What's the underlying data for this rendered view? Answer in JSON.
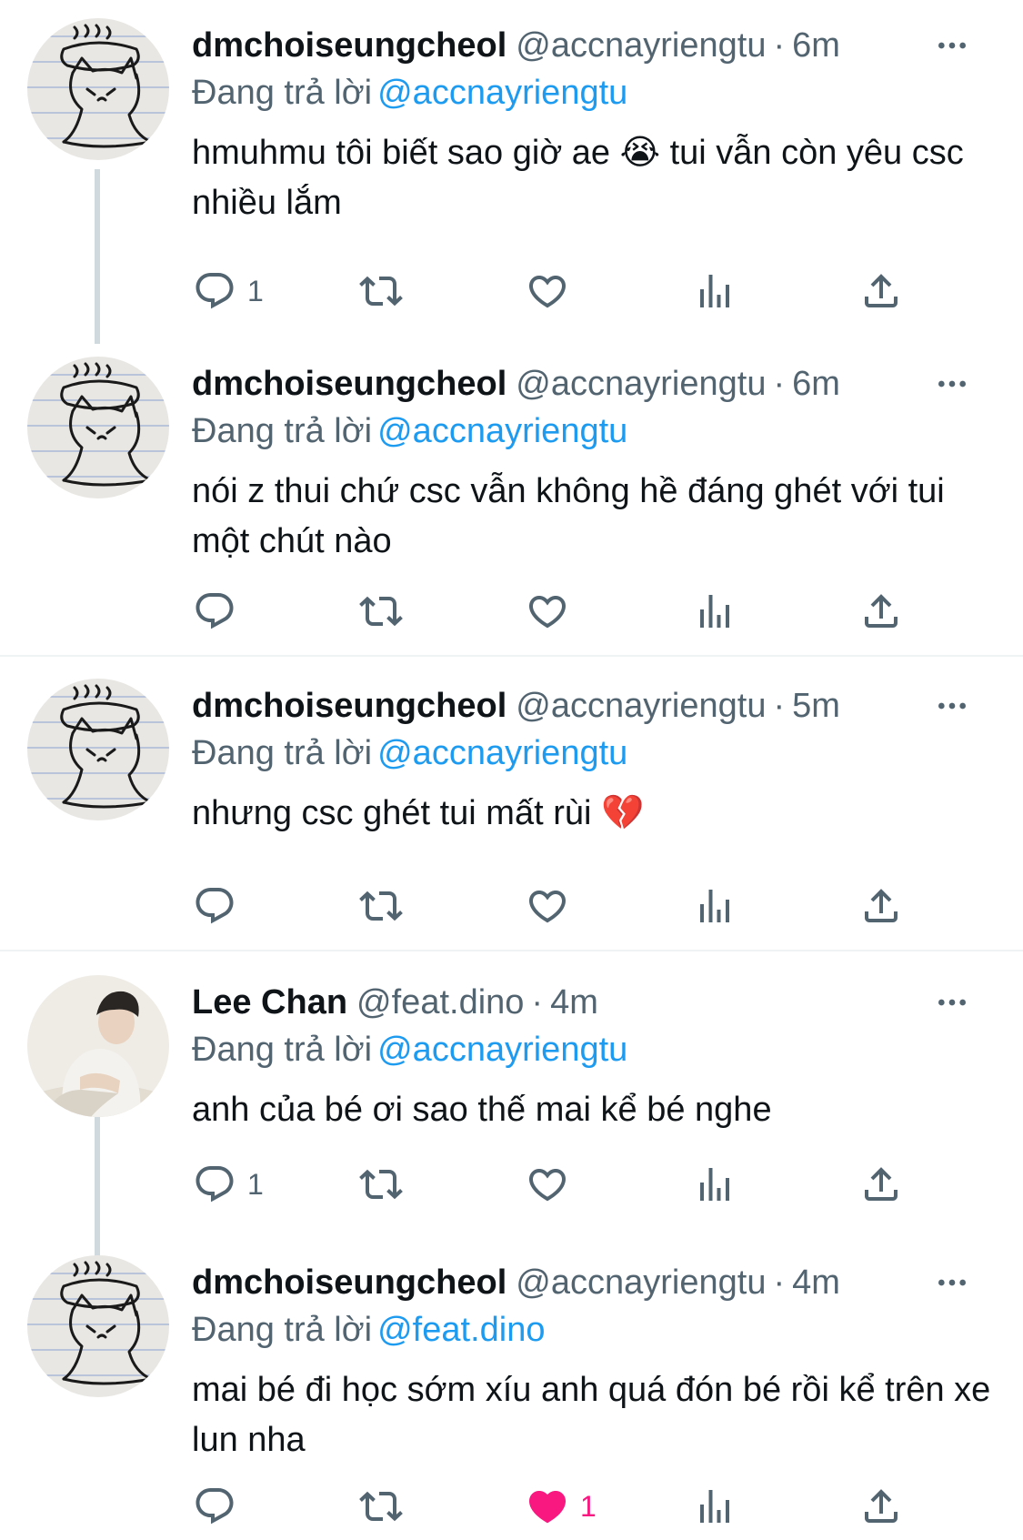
{
  "tweets": [
    {
      "name": "dmchoiseungcheol",
      "handle": "@accnayriengtu",
      "time": "6m",
      "reply_prefix": "Đang trả lời",
      "reply_to": "@accnayriengtu",
      "text": "hmuhmu tôi biết sao giờ ae 😭 tui vẫn còn yêu csc nhiều lắm",
      "reply_count": "1",
      "like_count": "",
      "liked": false,
      "avatar": "cat-drawing"
    },
    {
      "name": "dmchoiseungcheol",
      "handle": "@accnayriengtu",
      "time": "6m",
      "reply_prefix": "Đang trả lời",
      "reply_to": "@accnayriengtu",
      "text": "nói z thui chứ csc vẫn không hề đáng ghét với tui một chút nào",
      "reply_count": "",
      "like_count": "",
      "liked": false,
      "avatar": "cat-drawing"
    },
    {
      "name": "dmchoiseungcheol",
      "handle": "@accnayriengtu",
      "time": "5m",
      "reply_prefix": "Đang trả lời",
      "reply_to": "@accnayriengtu",
      "text": "nhưng csc ghét tui mất rùi 💔",
      "reply_count": "",
      "like_count": "",
      "liked": false,
      "avatar": "cat-drawing"
    },
    {
      "name": "Lee Chan",
      "handle": "@feat.dino",
      "time": "4m",
      "reply_prefix": "Đang trả lời",
      "reply_to": "@accnayriengtu",
      "text": "anh của bé ơi sao thế mai kể bé nghe",
      "reply_count": "1",
      "like_count": "",
      "liked": false,
      "avatar": "person-photo"
    },
    {
      "name": "dmchoiseungcheol",
      "handle": "@accnayriengtu",
      "time": "4m",
      "reply_prefix": "Đang trả lời",
      "reply_to": "@feat.dino",
      "text": "mai bé đi học sớm xíu anh quá đón bé rồi kể trên xe lun nha",
      "reply_count": "",
      "like_count": "1",
      "liked": true,
      "avatar": "cat-drawing"
    }
  ],
  "icons": {
    "reply": "reply-icon",
    "retweet": "retweet-icon",
    "like": "heart-icon",
    "views": "analytics-icon",
    "share": "share-icon",
    "more": "more-icon"
  },
  "colors": {
    "mention": "#1d9bf0",
    "secondary_text": "#536471",
    "like_active": "#f91880",
    "thread_line": "#cfd9de"
  }
}
